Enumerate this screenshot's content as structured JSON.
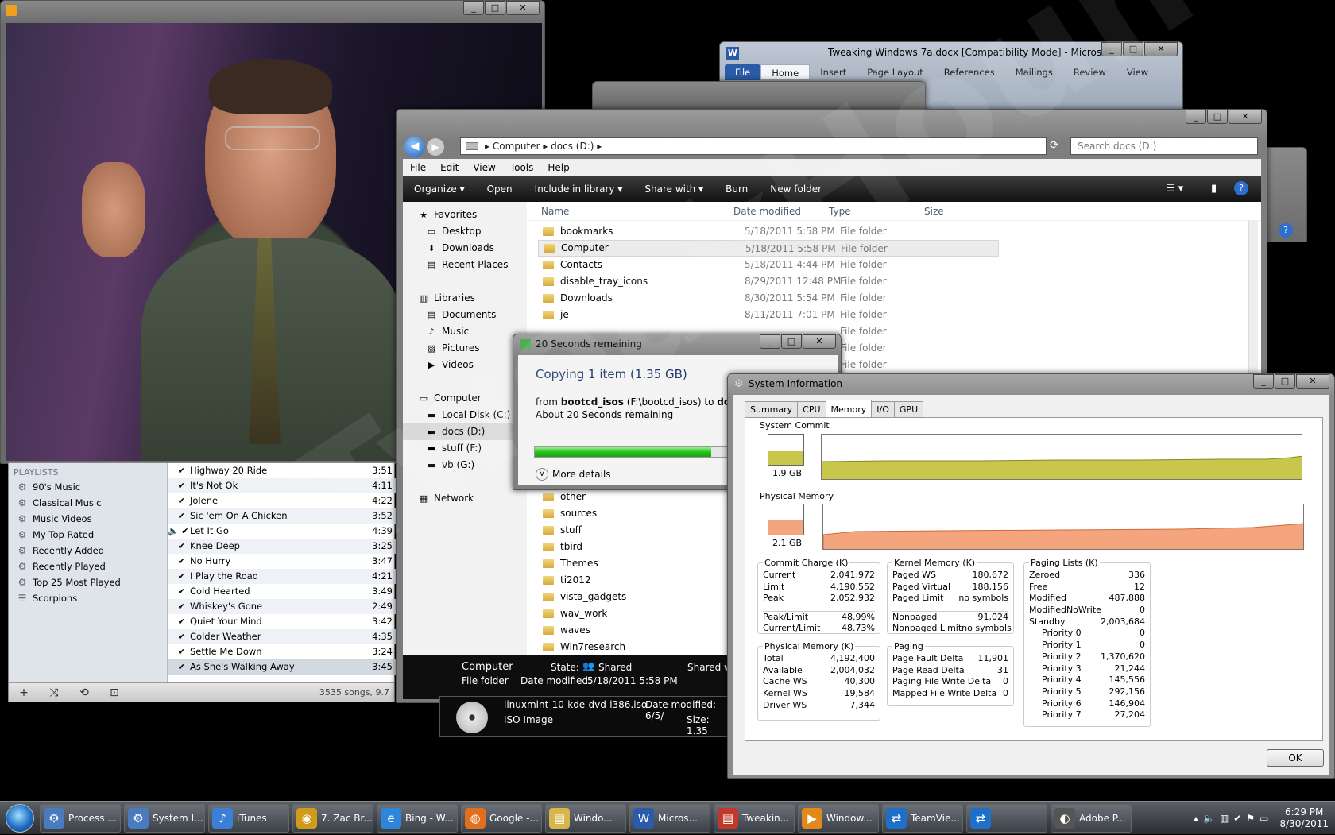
{
  "video_window": {
    "controls": [
      "_",
      "□",
      "✕"
    ]
  },
  "itunes": {
    "playlists_header": "PLAYLISTS",
    "playlists": [
      "90's Music",
      "Classical Music",
      "Music Videos",
      "My Top Rated",
      "Recently Added",
      "Recently Played",
      "Top 25 Most Played",
      "Scorpions"
    ],
    "tracks": [
      {
        "name": "Highway 20 Ride",
        "time": "3:51"
      },
      {
        "name": "It's Not Ok",
        "time": "4:11"
      },
      {
        "name": "Jolene",
        "time": "4:22"
      },
      {
        "name": "Sic 'em On A Chicken",
        "time": "3:52"
      },
      {
        "name": "Let It Go",
        "time": "4:39"
      },
      {
        "name": "Knee Deep",
        "time": "3:25"
      },
      {
        "name": "No Hurry",
        "time": "3:47"
      },
      {
        "name": "I Play the Road",
        "time": "4:21"
      },
      {
        "name": "Cold Hearted",
        "time": "3:49"
      },
      {
        "name": "Whiskey's Gone",
        "time": "2:49"
      },
      {
        "name": "Quiet Your Mind",
        "time": "3:42"
      },
      {
        "name": "Colder Weather",
        "time": "4:35"
      },
      {
        "name": "Settle Me Down",
        "time": "3:24"
      },
      {
        "name": "As She's Walking Away",
        "time": "3:45"
      }
    ],
    "status": "3535 songs, 9.7"
  },
  "word": {
    "title": "Tweaking Windows 7a.docx [Compatibility Mode] - Micros...",
    "tabs": [
      "File",
      "Home",
      "Insert",
      "Page Layout",
      "References",
      "Mailings",
      "Review",
      "View"
    ]
  },
  "explorer": {
    "breadcrumb": [
      "Computer",
      "docs (D:)"
    ],
    "search_placeholder": "Search docs (D:)",
    "menu": [
      "File",
      "Edit",
      "View",
      "Tools",
      "Help"
    ],
    "commands": [
      "Organize ▾",
      "Open",
      "Include in library ▾",
      "Share with ▾",
      "Burn",
      "New folder"
    ],
    "nav": [
      {
        "label": "Favorites",
        "icon": "★",
        "level": 0
      },
      {
        "label": "Desktop",
        "icon": "▭",
        "level": 1
      },
      {
        "label": "Downloads",
        "icon": "⬇",
        "level": 1
      },
      {
        "label": "Recent Places",
        "icon": "▤",
        "level": 1
      },
      {
        "label": "",
        "icon": "",
        "level": 0
      },
      {
        "label": "Libraries",
        "icon": "▥",
        "level": 0
      },
      {
        "label": "Documents",
        "icon": "▤",
        "level": 1
      },
      {
        "label": "Music",
        "icon": "♪",
        "level": 1
      },
      {
        "label": "Pictures",
        "icon": "▨",
        "level": 1
      },
      {
        "label": "Videos",
        "icon": "▶",
        "level": 1
      },
      {
        "label": "",
        "icon": "",
        "level": 0
      },
      {
        "label": "Computer",
        "icon": "▭",
        "level": 0
      },
      {
        "label": "Local Disk (C:)",
        "icon": "▬",
        "level": 1
      },
      {
        "label": "docs (D:)",
        "icon": "▬",
        "level": 1,
        "selected": true
      },
      {
        "label": "stuff (F:)",
        "icon": "▬",
        "level": 1
      },
      {
        "label": "vb (G:)",
        "icon": "▬",
        "level": 1
      },
      {
        "label": "",
        "icon": "",
        "level": 0
      },
      {
        "label": "Network",
        "icon": "▦",
        "level": 0
      }
    ],
    "columns": [
      "Name",
      "Date modified",
      "Type",
      "Size"
    ],
    "files_top": [
      {
        "name": "bookmarks",
        "date": "5/18/2011 5:58 PM",
        "type": "File folder"
      },
      {
        "name": "Computer",
        "date": "5/18/2011 5:58 PM",
        "type": "File folder",
        "selected": true
      },
      {
        "name": "Contacts",
        "date": "5/18/2011 4:44 PM",
        "type": "File folder"
      },
      {
        "name": "disable_tray_icons",
        "date": "8/29/2011 12:48 PM",
        "type": "File folder"
      },
      {
        "name": "Downloads",
        "date": "8/30/2011 5:54 PM",
        "type": "File folder"
      },
      {
        "name": "je",
        "date": "8/11/2011 7:01 PM",
        "type": "File folder"
      },
      {
        "name": "",
        "date": "",
        "type": "File folder"
      },
      {
        "name": "",
        "date": "",
        "type": "File folder"
      },
      {
        "name": "",
        "date": "",
        "type": "File folder"
      }
    ],
    "files_bottom": [
      "other",
      "sources",
      "stuff",
      "tbird",
      "Themes",
      "ti2012",
      "vista_gadgets",
      "wav_work",
      "waves",
      "Win7research"
    ],
    "details": {
      "name": "Computer",
      "type": "File folder",
      "state_label": "State:",
      "state": "Shared",
      "shared": "Shared w",
      "date_label": "Date modified:",
      "date": "5/18/2011 5:58 PM"
    }
  },
  "iso_window": {
    "name": "linuxmint-10-kde-dvd-i386.iso",
    "date": "Date modified: 6/5/",
    "type": "ISO Image",
    "size": "Size: 1.35"
  },
  "copy_dialog": {
    "title": "20 Seconds remaining",
    "heading": "Copying 1 item (1.35 GB)",
    "from_label": "from",
    "from_bold": "bootcd_isos",
    "from_path": "(F:\\bootcd_isos)",
    "to_label": "to",
    "to_bold": "docs",
    "to_path": "(D",
    "remaining": "About 20 Seconds remaining",
    "more": "More details",
    "progress": 0.62
  },
  "sysinfo": {
    "title": "System Information",
    "tabs": [
      "Summary",
      "CPU",
      "Memory",
      "I/O",
      "GPU"
    ],
    "active_tab": "Memory",
    "commit_label": "System Commit",
    "commit_value": "1.9 GB",
    "phys_label": "Physical Memory",
    "phys_value": "2.1 GB",
    "commit_charge": {
      "title": "Commit Charge (K)",
      "rows": [
        [
          "Current",
          "2,041,972"
        ],
        [
          "Limit",
          "4,190,552"
        ],
        [
          "Peak",
          "2,052,932"
        ],
        [
          "Peak/Limit",
          "48.99%"
        ],
        [
          "Current/Limit",
          "48.73%"
        ]
      ]
    },
    "physical": {
      "title": "Physical Memory (K)",
      "rows": [
        [
          "Total",
          "4,192,400"
        ],
        [
          "Available",
          "2,004,032"
        ],
        [
          "Cache WS",
          "40,300"
        ],
        [
          "Kernel WS",
          "19,584"
        ],
        [
          "Driver WS",
          "7,344"
        ]
      ]
    },
    "kernel": {
      "title": "Kernel Memory (K)",
      "rows": [
        [
          "Paged WS",
          "180,672"
        ],
        [
          "Paged Virtual",
          "188,156"
        ],
        [
          "Paged Limit",
          "no symbols"
        ],
        [
          "Nonpaged",
          "91,024"
        ],
        [
          "Nonpaged Limit",
          "no symbols"
        ]
      ]
    },
    "paging": {
      "title": "Paging",
      "rows": [
        [
          "Page Fault Delta",
          "11,901"
        ],
        [
          "Page Read Delta",
          "31"
        ],
        [
          "Paging File Write Delta",
          "0"
        ],
        [
          "Mapped File Write Delta",
          "0"
        ]
      ]
    },
    "paging_lists": {
      "title": "Paging Lists (K)",
      "rows": [
        [
          "Zeroed",
          "336"
        ],
        [
          "Free",
          "12"
        ],
        [
          "Modified",
          "487,888"
        ],
        [
          "ModifiedNoWrite",
          "0"
        ],
        [
          "Standby",
          "2,003,684"
        ],
        [
          "Priority 0",
          "0"
        ],
        [
          "Priority 1",
          "0"
        ],
        [
          "Priority 2",
          "1,370,620"
        ],
        [
          "Priority 3",
          "21,244"
        ],
        [
          "Priority 4",
          "145,556"
        ],
        [
          "Priority 5",
          "292,156"
        ],
        [
          "Priority 6",
          "146,904"
        ],
        [
          "Priority 7",
          "27,204"
        ]
      ]
    },
    "ok": "OK"
  },
  "taskbar": {
    "items": [
      {
        "label": "Process ...",
        "icon": "⚙",
        "color": "#4a7bbf"
      },
      {
        "label": "System I...",
        "icon": "⚙",
        "color": "#4a7bbf"
      },
      {
        "label": "iTunes",
        "icon": "♪",
        "color": "#3a7fd8"
      },
      {
        "label": "7. Zac Br...",
        "icon": "◉",
        "color": "#d09a1a"
      },
      {
        "label": "Bing - W...",
        "icon": "e",
        "color": "#2f86d8"
      },
      {
        "label": "Google -...",
        "icon": "◍",
        "color": "#e0701c"
      },
      {
        "label": "Windo...",
        "icon": "▤",
        "color": "#d8b64a"
      },
      {
        "label": "Micros...",
        "icon": "W",
        "color": "#2a5ba8"
      },
      {
        "label": "Tweakin...",
        "icon": "▤",
        "color": "#c0392b"
      },
      {
        "label": "Window...",
        "icon": "▶",
        "color": "#e08a1c"
      },
      {
        "label": "TeamVie...",
        "icon": "⇄",
        "color": "#1e6fc8"
      },
      {
        "label": "",
        "icon": "⇄",
        "color": "#1e6fc8"
      },
      {
        "label": "Adobe P...",
        "icon": "◐",
        "color": "#555"
      }
    ],
    "time": "6:29 PM",
    "date": "8/30/2011"
  },
  "watermark": "TweakHound.com"
}
